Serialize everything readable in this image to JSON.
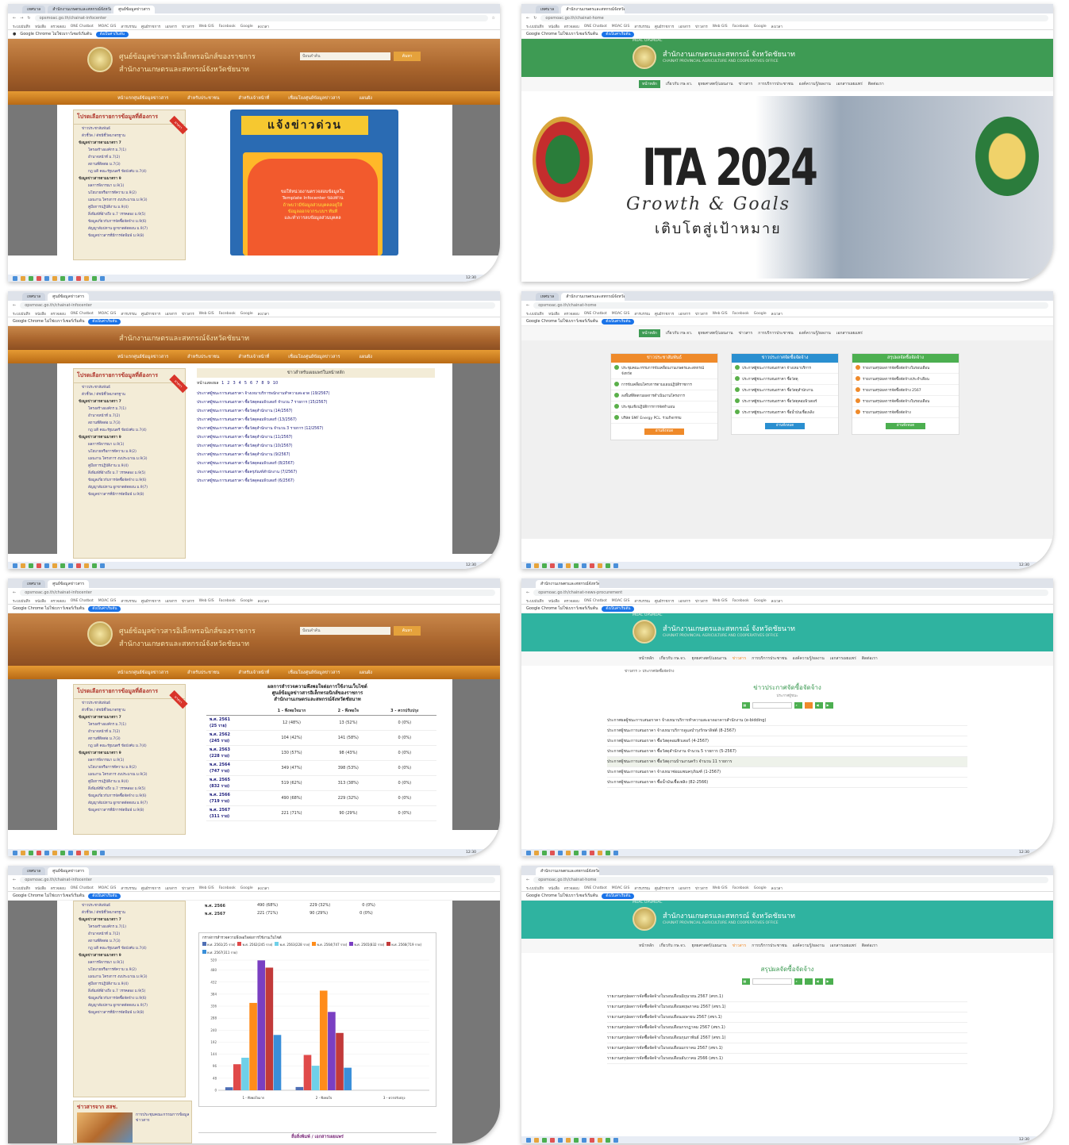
{
  "browser": {
    "tab_1": "เทศบาล",
    "tab_2": "สำนักงานเกษตรและสหกรณ์จังหวัด",
    "tab_3": "ศูนย์ข้อมูลข่าวสาร",
    "infobar_text": "Google Chrome ไม่ใช่เบราว์เซอร์เริ่มต้น",
    "infobar_button": "ตั้งเป็นค่าเริ่มต้น",
    "url_infocenter": "opsmoac.go.th/chainat-infocenter",
    "url_home": "opsmoac.go.th/chainat-home",
    "url_procure": "opsmoac.go.th/chainat-news-procurement",
    "bookmarks": [
      "ระบบบันทึก",
      "หนังสือ",
      "ตรวจสอบ",
      "ONE Chatbot",
      "MOAC GIS",
      "สารบรรณ",
      "ศูนย์ราชการ",
      "เอกสาร",
      "ข่าวสาร",
      "Web GIS",
      "Facebook",
      "Google",
      "ลงเวลา"
    ],
    "taskbar_time": "12:30"
  },
  "infocenter": {
    "title_line1": "ศูนย์ข้อมูลข่าวสารอิเล็กทรอนิกส์ของราชการ",
    "title_line2": "สำนักงานเกษตรและสหกรณ์จังหวัดชัยนาท",
    "search_placeholder": "ป้อนคำค้น",
    "search_button": "ค้นหา",
    "nav": [
      "หน้าแรกศูนย์ข้อมูลข่าวสาร",
      "สำหรับประชาชน",
      "สำหรับเจ้าหน้าที่",
      "เชื่อมโยงศูนย์ข้อมูลข่าวสาร",
      "แผนผัง"
    ],
    "sidebar_title": "โปรดเลือกรายการข้อมูลที่ต้องการ",
    "sidebar_ribbon": "มาตรา",
    "sidebar_items": [
      {
        "label": "ข่าวประชาสัมพันธ์",
        "level": "item"
      },
      {
        "label": "ตัวชี้วัด / ดัชนีชี้วัดมาตรฐาน",
        "level": "item"
      },
      {
        "label": "ข้อมูลข่าวสารตามมาตรา 7",
        "level": "group"
      },
      {
        "label": "โครงสร้างองค์กร ม.7(1)",
        "level": "sub"
      },
      {
        "label": "อำนาจหน้าที่ ม.7(2)",
        "level": "sub"
      },
      {
        "label": "สถานที่ติดต่อ ม.7(3)",
        "level": "sub"
      },
      {
        "label": "กฎ มติ คณะรัฐมนตรี ข้อบังคับ ม.7(4)",
        "level": "sub"
      },
      {
        "label": "ข้อมูลข่าวสารตามมาตรา 9",
        "level": "group"
      },
      {
        "label": "ผลการพิจารณา ม.9(1)",
        "level": "sub"
      },
      {
        "label": "นโยบายหรือการตีความ ม.9(2)",
        "level": "sub"
      },
      {
        "label": "แผนงาน โครงการ งบประมาณ ม.9(3)",
        "level": "sub"
      },
      {
        "label": "คู่มือการปฏิบัติงาน ม.9(4)",
        "level": "sub"
      },
      {
        "label": "สิ่งพิมพ์ที่อ้างถึง ม.7 วรรคสอง ม.9(5)",
        "level": "sub"
      },
      {
        "label": "ข้อมูลเกี่ยวกับการจัดซื้อจัดจ้าง ม.9(6)",
        "level": "sub"
      },
      {
        "label": "สัญญาสัมปทาน ผูกขาดตัดตอน ม.9(7)",
        "level": "sub"
      },
      {
        "label": "ข้อมูลข่าวสารที่มีการจัดพิมพ์ ม.9(8)",
        "level": "sub"
      }
    ],
    "poster_title": "แจ้งข่าวด่วน",
    "poster_line1": "ขอให้หน่วยงานตรวจสอบข้อมูลใน",
    "poster_line2": "Template Infocenter ของท่าน",
    "poster_line3": "ถ้าพบว่ามีข้อมูลส่วนบุคคลอยู่ให้",
    "poster_line4": "ข้อมูลออกจากระบบฯ ทันที",
    "poster_line5": "และทำการลบข้อมูลส่วนบุคคล"
  },
  "home": {
    "top_links": "MOAC  OPSMOAC",
    "title": "สำนักงานเกษตรและสหกรณ์ จังหวัดชัยนาท",
    "subtitle": "CHAINAT PROVINCIAL AGRICULTURE AND COOPERATIVES OFFICE",
    "nav": [
      "หน้าหลัก",
      "เกี่ยวกับ กษ.จว.",
      "ยุทธศาสตร์/แผนงาน",
      "ข่าวสาร",
      "การบริการประชาชน",
      "องค์ความรู้/ผลงาน",
      "เอกสารเผยแพร่",
      "ติดต่อเรา"
    ],
    "banner_big": "ITA 2024",
    "banner_en": "Growth & Goals",
    "banner_th": "เติบโตสู่เป้าหมาย"
  },
  "news_list": {
    "header": "ข่าวสำหรับเผยแพร่ในหน้าหลัก",
    "pages_label": "หน้าแสดงผล",
    "pages": [
      "1",
      "2",
      "3",
      "4",
      "5",
      "6",
      "7",
      "8",
      "9",
      "10"
    ],
    "items": [
      "ประกาศผู้ชนะการเสนอราคา จ้างเหมาบริการพนักงานทำความสะอาด (19/2567)",
      "ประกาศผู้ชนะการเสนอราคา ซื้อวัสดุคอมพิวเตอร์ จำนวน 7 รายการ (15/2567)",
      "ประกาศผู้ชนะการเสนอราคา ซื้อวัสดุสำนักงาน (14/2567)",
      "ประกาศผู้ชนะการเสนอราคา ซื้อวัสดุคอมพิวเตอร์ (13/2567)",
      "ประกาศผู้ชนะการเสนอราคา ซื้อวัสดุสำนักงาน จำนวน 3 รายการ (12/2567)",
      "ประกาศผู้ชนะการเสนอราคา ซื้อวัสดุสำนักงาน (11/2567)",
      "ประกาศผู้ชนะการเสนอราคา ซื้อวัสดุสำนักงาน (10/2567)",
      "ประกาศผู้ชนะการเสนอราคา ซื้อวัสดุสำนักงาน (9/2567)",
      "ประกาศผู้ชนะการเสนอราคา ซื้อวัสดุคอมพิวเตอร์ (8/2567)",
      "ประกาศผู้ชนะการเสนอราคา ซื้อครุภัณฑ์สำนักงาน (7/2567)",
      "ประกาศผู้ชนะการเสนอราคา ซื้อวัสดุคอมพิวเตอร์ (6/2567)"
    ]
  },
  "home_columns": {
    "col1_title": "ข่าวประชาสัมพันธ์",
    "col2_title": "ข่าวประกาศจัดซื้อจัดจ้าง",
    "col3_title": "สรุปผลจัดซื้อจัดจ้าง",
    "col1_items": [
      "ประชุมคณะกรรมการขับเคลื่อนงานเกษตรและสหกรณ์จังหวัด",
      "การขับเคลื่อนโครงการตามแผนปฏิบัติราชการ",
      "ลงพื้นที่ติดตามผลการดำเนินงานโครงการ",
      "ประชุมเชิงปฏิบัติการการจัดทำแผน",
      "บริษัท SMF Energy PCL. ร่วมกิจกรรม"
    ],
    "col2_items": [
      "ประกาศผู้ชนะการเสนอราคา จ้างเหมาบริการ",
      "ประกาศผู้ชนะการเสนอราคา ซื้อวัสดุ",
      "ประกาศผู้ชนะการเสนอราคา ซื้อวัสดุสำนักงาน",
      "ประกาศผู้ชนะการเสนอราคา ซื้อวัสดุคอมพิวเตอร์",
      "ประกาศผู้ชนะการเสนอราคา ซื้อน้ำมันเชื้อเพลิง"
    ],
    "col3_items": [
      "รายงานสรุปผลการจัดซื้อจัดจ้างในรอบเดือน",
      "รายงานสรุปผลการจัดซื้อจัดจ้างประจำเดือน",
      "รายงานสรุปผลการจัดซื้อจัดจ้าง 2567",
      "รายงานสรุปผลการจัดซื้อจัดจ้างในรอบเดือน",
      "รายงานสรุปผลการจัดซื้อจัดจ้าง"
    ],
    "more": "อ่านทั้งหมด"
  },
  "survey": {
    "title_line1": "ผลการสำรวจความพึงพอใจต่อการใช้งานเว็บไซต์",
    "title_line2": "ศูนย์ข้อมูลข่าวสารอิเล็กทรอนิกส์ของราชการ",
    "title_line3": "สำนักงานเกษตรและสหกรณ์จังหวัดชัยนาท",
    "col_headers": [
      "1 - พึงพอใจมาก",
      "2 - พึงพอใจ",
      "3 - ควรปรับปรุง"
    ],
    "rows": [
      {
        "year": "พ.ศ. 2561",
        "n": "(25 ราย)",
        "v": [
          "12 (48%)",
          "13 (52%)",
          "0 (0%)"
        ]
      },
      {
        "year": "พ.ศ. 2562",
        "n": "(245 ราย)",
        "v": [
          "104 (42%)",
          "141 (58%)",
          "0 (0%)"
        ]
      },
      {
        "year": "พ.ศ. 2563",
        "n": "(228 ราย)",
        "v": [
          "130 (57%)",
          "98 (43%)",
          "0 (0%)"
        ]
      },
      {
        "year": "พ.ศ. 2564",
        "n": "(747 ราย)",
        "v": [
          "349 (47%)",
          "398 (53%)",
          "0 (0%)"
        ]
      },
      {
        "year": "พ.ศ. 2565",
        "n": "(832 ราย)",
        "v": [
          "519 (62%)",
          "313 (38%)",
          "0 (0%)"
        ]
      },
      {
        "year": "พ.ศ. 2566",
        "n": "(719 ราย)",
        "v": [
          "490 (68%)",
          "229 (32%)",
          "0 (0%)"
        ]
      },
      {
        "year": "พ.ศ. 2567",
        "n": "(311 ราย)",
        "v": [
          "221 (71%)",
          "90 (29%)",
          "0 (0%)"
        ]
      }
    ]
  },
  "procure_page": {
    "breadcrumb": "ข่าวสาร > ประกาศจัดซื้อจัดจ้าง",
    "title": "ข่าวประกาศจัดซื้อจัดจ้าง",
    "subtitle": "ประกาศผู้ชนะ",
    "items": [
      "ประกาศผลผู้ชนะการเสนอราคา จ้างเหมาบริการทำความสะอาดอาคารสำนักงาน (e-bidding)",
      "ประกาศผู้ชนะการเสนอราคา จ้างเหมาบริการดูแลบำรุงรักษาลิฟต์ (8-2567)",
      "ประกาศผู้ชนะการเสนอราคา ซื้อวัสดุคอมพิวเตอร์ (4-2567)",
      "ประกาศผู้ชนะการเสนอราคา ซื้อวัสดุสำนักงาน จำนวน 5 รายการ (5-2567)",
      "ประกาศผู้ชนะการเสนอราคา ซื้อวัสดุงานบ้านงานครัว จำนวน 11 รายการ",
      "ประกาศผู้ชนะการเสนอราคา จ้างเหมาซ่อมแซมครุภัณฑ์ (1-2567)",
      "ประกาศผู้ชนะการเสนอราคา ซื้อน้ำมันเชื้อเพลิง (82-2566)"
    ]
  },
  "chart_panel": {
    "legend_title": "กราฟการสำรวจความพึงพอใจต่อการใช้งานเว็บไซต์",
    "pr_title": "ข่าวสารจาก สสช.",
    "pr_text": "การประชุมคณะกรรมการข้อมูลข่าวสาร",
    "footer": "สื่อสิ่งพิมพ์ / เอกสารเผยแพร่"
  },
  "chart_data": {
    "type": "bar",
    "categories": [
      "1 - พึงพอใจมาก",
      "2 - พึงพอใจ",
      "3 - ควรปรับปรุง"
    ],
    "series": [
      {
        "name": "พ.ศ. 2561(25 ราย)",
        "values": [
          12,
          13,
          0
        ],
        "color": "#4f6fb5"
      },
      {
        "name": "พ.ศ. 2562(245 ราย)",
        "values": [
          104,
          141,
          0
        ],
        "color": "#e04a4a"
      },
      {
        "name": "พ.ศ. 2563(228 ราย)",
        "values": [
          130,
          98,
          0
        ],
        "color": "#6fd0e8"
      },
      {
        "name": "พ.ศ. 2564(747 ราย)",
        "values": [
          349,
          398,
          0
        ],
        "color": "#ff8c1a"
      },
      {
        "name": "พ.ศ. 2565(832 ราย)",
        "values": [
          519,
          313,
          0
        ],
        "color": "#7a3fc2"
      },
      {
        "name": "พ.ศ. 2566(719 ราย)",
        "values": [
          490,
          229,
          0
        ],
        "color": "#c23a3a"
      },
      {
        "name": "พ.ศ. 2567(311 ราย)",
        "values": [
          221,
          90,
          0
        ],
        "color": "#3a8fd9"
      }
    ],
    "ylim": [
      0,
      520
    ],
    "yticks": [
      0,
      48,
      96,
      144,
      192,
      240,
      288,
      336,
      384,
      432,
      480,
      520
    ]
  },
  "summary_page": {
    "title": "สรุปผลจัดซื้อจัดจ้าง",
    "items": [
      "รายงานสรุปผลการจัดซื้อจัดจ้างในรอบเดือนมิถุนายน 2567 (สขร.1)",
      "รายงานสรุปผลการจัดซื้อจัดจ้างในรอบเดือนพฤษภาคม 2567 (สขร.1)",
      "รายงานสรุปผลการจัดซื้อจัดจ้างในรอบเดือนเมษายน 2567 (สขร.1)",
      "รายงานสรุปผลการจัดซื้อจัดจ้างในรอบเดือนกรกฎาคม 2567 (สขร.1)",
      "รายงานสรุปผลการจัดซื้อจัดจ้างในรอบเดือนกุมภาพันธ์ 2567 (สขร.1)",
      "รายงานสรุปผลการจัดซื้อจัดจ้างในรอบเดือนมกราคม 2567 (สขร.1)",
      "รายงานสรุปผลการจัดซื้อจัดจ้างในรอบเดือนธันวาคม 2566 (สขร.1)"
    ]
  }
}
